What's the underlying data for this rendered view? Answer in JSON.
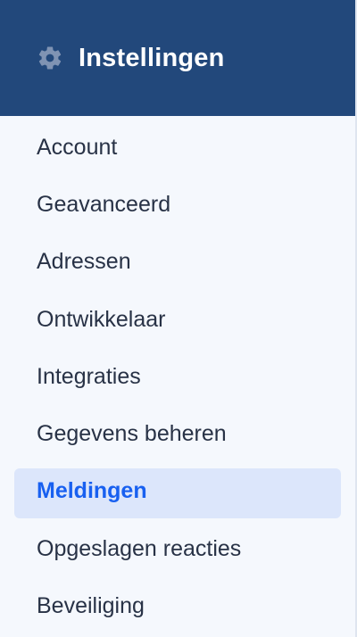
{
  "header": {
    "title": "Instellingen",
    "icon": "gear-icon"
  },
  "colors": {
    "header_bg": "#22487b",
    "sidebar_bg": "#f5f8fd",
    "active_bg": "#dce6fb",
    "active_text": "#1860f0",
    "text": "#283246"
  },
  "menu": {
    "items": [
      {
        "label": "Account",
        "active": false
      },
      {
        "label": "Geavanceerd",
        "active": false
      },
      {
        "label": "Adressen",
        "active": false
      },
      {
        "label": "Ontwikkelaar",
        "active": false
      },
      {
        "label": "Integraties",
        "active": false
      },
      {
        "label": "Gegevens beheren",
        "active": false
      },
      {
        "label": "Meldingen",
        "active": true
      },
      {
        "label": "Opgeslagen reacties",
        "active": false
      },
      {
        "label": "Beveiliging",
        "active": false
      }
    ]
  }
}
